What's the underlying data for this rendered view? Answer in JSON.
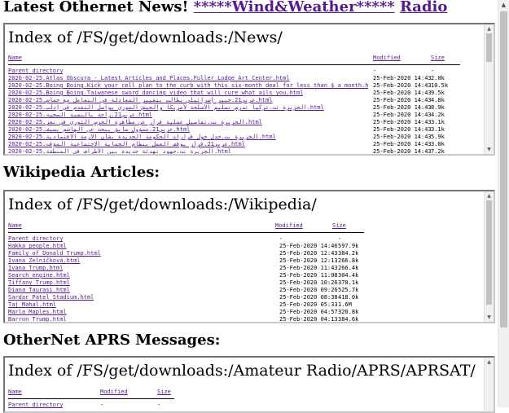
{
  "header": {
    "title": "Latest Othernet News!",
    "link_weather": "*****Wind&Weather*****",
    "link_radio": "Radio"
  },
  "news": {
    "index_title": "Index of /FS/get/downloads:/News/",
    "columns": {
      "name": "Name",
      "modified": "Modified",
      "size": "Size"
    },
    "rows": [
      {
        "name": "Parent directory",
        "modified": "-",
        "size": "-"
      },
      {
        "name": "2020-02-25.Atlas Obscura - Latest Articles and Places.Fuller Lodge Art Center.html",
        "modified": "25-Feb-2020 14:43",
        "size": "2.0k"
      },
      {
        "name": "2020-02-25.Boing Boing.Kick your cell plan to the curb with this six-month deal for less than $ a month.html",
        "modified": "25-Feb-2020 14:43",
        "size": "10.5k"
      },
      {
        "name": "2020-02-25.Boing Boing.Taiwanese sword dancing video that will cure what ails you.html",
        "modified": "25-Feb-2020 14:43",
        "size": "9.5k"
      },
      {
        "name": "2020-02-25.عربي21.خبير إسرائيلي يطالب بتغيير المعادلة في التعامل مع حماس.html",
        "modified": "25-Feb-2020 14:43",
        "size": "4.8k"
      },
      {
        "name": "2020-02-25.الجزيرة نت.تركيا تدرس تسليم الأسلحة لأمريكا والجيش السوري يواصل التقدم في إدلب.html",
        "modified": "25-Feb-2020 14:43",
        "size": "8.9k"
      },
      {
        "name": "2020-02-25.عربي21.راحة بالنسبة الصحية.html",
        "modified": "25-Feb-2020 14:43",
        "size": "4.2k"
      },
      {
        "name": "2020-02-25.الجزيرة نت.تفاصيل عملية فرار عن مظاهرة الحرس الثوري في تعز.html",
        "modified": "25-Feb-2020 14:43",
        "size": "3.1k"
      },
      {
        "name": "2020-02-25.عربي21.مسؤول سابق يبحث عن الهاشم بسيف.html",
        "modified": "25-Feb-2020 14:43",
        "size": "3.1k"
      },
      {
        "name": "2020-02-25.الجزيرة نت.جدل حول قرارات الحكومة الجديدة بشأن الأزمة الاقتصادية.html",
        "modified": "25-Feb-2020 14:43",
        "size": "5.9k"
      },
      {
        "name": "2020-02-25.عربي21.قرار يوقف العمل بنظام الحماية الاجتماعية المؤقت.html",
        "modified": "25-Feb-2020 14:43",
        "size": "3.0k"
      },
      {
        "name": "2020-02-25.الجزيرة نت.جهود تهدئة جديدة بين الأطراف في المنطقة.html",
        "modified": "25-Feb-2020 14:43",
        "size": "7.2k"
      }
    ]
  },
  "wiki_header": "Wikipedia Articles:",
  "wiki": {
    "index_title": "Index of /FS/get/downloads:/Wikipedia/",
    "columns": {
      "name": "Name",
      "modified": "Modified",
      "size": "Size"
    },
    "rows": [
      {
        "name": "Parent directory",
        "modified": "-",
        "size": "-"
      },
      {
        "name": "Hakka_people.html",
        "modified": "25-Feb-2020 14:46",
        "size": "597.9k"
      },
      {
        "name": "Family_of_Donald_Trump.html",
        "modified": "25-Feb-2020 12:43",
        "size": "384.2k"
      },
      {
        "name": "Ivana_Zelníčková.html",
        "modified": "25-Feb-2020 12:13",
        "size": "266.8k"
      },
      {
        "name": "Ivana_Trump.html",
        "modified": "25-Feb-2020 11:43",
        "size": "266.4k"
      },
      {
        "name": "Search_engine.html",
        "modified": "25-Feb-2020 11:08",
        "size": "304.4k"
      },
      {
        "name": "Tiffany_Trump.html",
        "modified": "25-Feb-2020 10:26",
        "size": "370.1k"
      },
      {
        "name": "Diana_Taurasi.html",
        "modified": "25-Feb-2020 09:26",
        "size": "525.7k"
      },
      {
        "name": "Sardar_Patel_Stadium.html",
        "modified": "25-Feb-2020 08:38",
        "size": "418.0k"
      },
      {
        "name": "Taj_Mahal.html",
        "modified": "25-Feb-2020 05:33",
        "size": "1.6M"
      },
      {
        "name": "Marla_Maples.html",
        "modified": "25-Feb-2020 04:57",
        "size": "320.8k"
      },
      {
        "name": "Barron_Trump.html",
        "modified": "25-Feb-2020 04:13",
        "size": "384.6k"
      }
    ]
  },
  "aprs_header": "OtherNet APRS Messages:",
  "aprs": {
    "index_title": "Index of /FS/get/downloads:/Amateur Radio/APRS/APRSAT/",
    "columns": {
      "name": "Name",
      "modified": "Modified",
      "size": "Size"
    },
    "rows": [
      {
        "name": "Parent directory",
        "modified": "-",
        "size": "-"
      }
    ]
  }
}
